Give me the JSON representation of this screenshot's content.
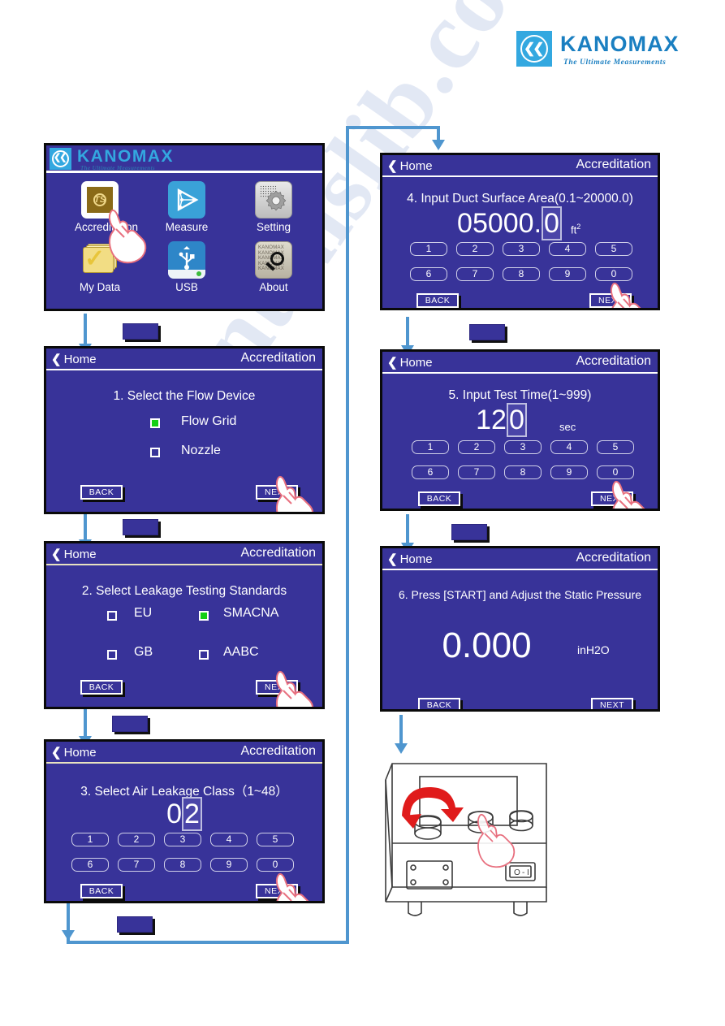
{
  "brand": {
    "name": "KANOMAX",
    "tagline": "The Ultimate Measurements",
    "mark_icon": "kanomax-double-chevron-icon"
  },
  "colors": {
    "screen_bg": "#383399",
    "accent_blue": "#4f96cf",
    "brand_blue": "#1a7fc1",
    "checkbox_on": "#14d014",
    "outline": "#0a0a0a",
    "hand_outline": "#e8707f",
    "knob_arrow_red": "#e01b1b"
  },
  "watermark": {
    "text": "manualslib.com"
  },
  "screens": [
    {
      "id": "home",
      "kind": "home-menu",
      "splash": {
        "word": "KANOMAX",
        "tagline": "The Ultimate Measurements"
      },
      "apps": [
        {
          "label": "Accreditation",
          "icon": "accreditation-ts-icon"
        },
        {
          "label": "Measure",
          "icon": "measure-play-icon"
        },
        {
          "label": "Setting",
          "icon": "gear-icon"
        },
        {
          "label": "My Data",
          "icon": "folder-check-icon"
        },
        {
          "label": "USB",
          "icon": "usb-icon"
        },
        {
          "label": "About",
          "icon": "magnifier-document-icon"
        }
      ]
    },
    {
      "id": "step1",
      "kind": "choice",
      "home_label": "Home",
      "title": "Accreditation",
      "step_title": "1. Select the Flow Device",
      "options": [
        {
          "label": "Flow Grid",
          "selected": true
        },
        {
          "label": "Nozzle",
          "selected": false
        }
      ],
      "back_label": "BACK",
      "next_label": "NEXT"
    },
    {
      "id": "step2",
      "kind": "choice-grid",
      "home_label": "Home",
      "title": "Accreditation",
      "step_title": "2. Select Leakage Testing Standards",
      "options": [
        {
          "label": "EU",
          "selected": false
        },
        {
          "label": "SMACNA",
          "selected": true
        },
        {
          "label": "GB",
          "selected": false
        },
        {
          "label": "AABC",
          "selected": false
        }
      ],
      "back_label": "BACK",
      "next_label": "NEXT"
    },
    {
      "id": "step3",
      "kind": "keypad",
      "home_label": "Home",
      "title": "Accreditation",
      "step_title": "3. Select Air Leakage Class（1~48）",
      "value_prefix": "0",
      "value_cursor": "2",
      "unit": "",
      "keys": [
        "1",
        "2",
        "3",
        "4",
        "5",
        "6",
        "7",
        "8",
        "9",
        "0"
      ],
      "back_label": "BACK",
      "next_label": "NEXT"
    },
    {
      "id": "step4",
      "kind": "keypad",
      "home_label": "Home",
      "title": "Accreditation",
      "step_title": "4. Input Duct Surface Area(0.1~20000.0)",
      "value_prefix": "05000.",
      "value_cursor": "0",
      "unit": "ft",
      "unit_sup": "2",
      "keys": [
        "1",
        "2",
        "3",
        "4",
        "5",
        "6",
        "7",
        "8",
        "9",
        "0"
      ],
      "back_label": "BACK",
      "next_label": "NEXT"
    },
    {
      "id": "step5",
      "kind": "keypad",
      "home_label": "Home",
      "title": "Accreditation",
      "step_title": "5. Input Test Time(1~999)",
      "value_prefix": "12",
      "value_cursor": "0",
      "unit": "sec",
      "keys": [
        "1",
        "2",
        "3",
        "4",
        "5",
        "6",
        "7",
        "8",
        "9",
        "0"
      ],
      "back_label": "BACK",
      "next_label": "NEXT"
    },
    {
      "id": "step6",
      "kind": "readout",
      "home_label": "Home",
      "title": "Accreditation",
      "step_title": "6. Press [START] and Adjust the Static Pressure",
      "value": "0.000",
      "unit": "inH2O",
      "back_label": "BACK",
      "next_label": "NEXT"
    }
  ],
  "device_illustration": {
    "icon": "benchtop-instrument-icon",
    "knob_rotate_icon": "rotate-knob-arrow-icon",
    "press_hand_icon": "pointing-hand-icon",
    "power_switch_icon": "power-rocker-switch-icon",
    "power_switch_labels": "O - I"
  }
}
